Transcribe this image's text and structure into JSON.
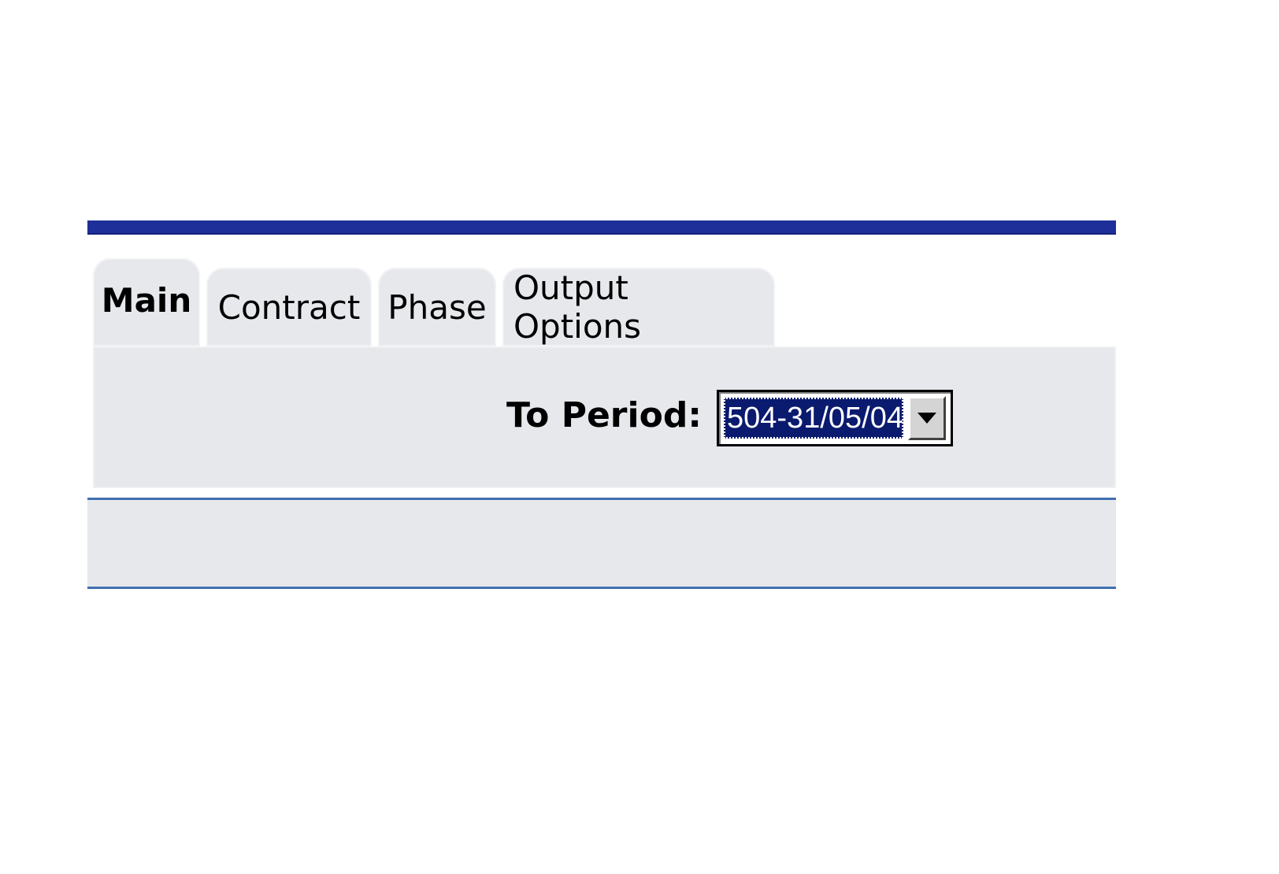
{
  "tabs": [
    {
      "label": "Main",
      "active": true
    },
    {
      "label": "Contract",
      "active": false
    },
    {
      "label": "Phase",
      "active": false
    },
    {
      "label": "Output Options",
      "active": false
    }
  ],
  "main_panel": {
    "to_period_label": "To Period:",
    "to_period_value": "504-31/05/04"
  },
  "colors": {
    "header_rule": "#1f2f9a",
    "panel_background": "#e6e8ec",
    "separator": "#3f6fb0",
    "selection_background": "#0a1a6e"
  },
  "icons": {
    "dropdown": "chevron-down-icon"
  }
}
